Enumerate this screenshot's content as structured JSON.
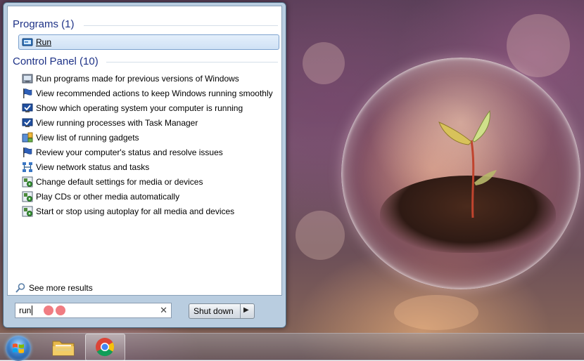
{
  "programs": {
    "header": "Programs (1)",
    "items": [
      {
        "label": "Run",
        "icon": "run-icon"
      }
    ]
  },
  "control_panel": {
    "header": "Control Panel (10)",
    "items": [
      {
        "label": "Run programs made for previous versions of Windows",
        "icon": "compatibility-icon"
      },
      {
        "label": "View recommended actions to keep Windows running smoothly",
        "icon": "action-center-flag-icon"
      },
      {
        "label": "Show which operating system your computer is running",
        "icon": "system-check-icon"
      },
      {
        "label": "View running processes with Task Manager",
        "icon": "task-manager-icon"
      },
      {
        "label": "View list of running gadgets",
        "icon": "gadgets-icon"
      },
      {
        "label": "Review your computer's status and resolve issues",
        "icon": "action-center-flag-icon"
      },
      {
        "label": "View network status and tasks",
        "icon": "network-icon"
      },
      {
        "label": "Change default settings for media or devices",
        "icon": "autoplay-icon"
      },
      {
        "label": "Play CDs or other media automatically",
        "icon": "autoplay-icon"
      },
      {
        "label": "Start or stop using autoplay for all media and devices",
        "icon": "autoplay-icon"
      }
    ]
  },
  "see_more": {
    "label": "See more results",
    "icon": "search-icon"
  },
  "search": {
    "value": "run",
    "clear_icon": "close-icon"
  },
  "shutdown": {
    "label": "Shut down",
    "arrow_icon": "chevron-right-icon"
  },
  "taskbar": {
    "start": {
      "icon": "windows-start-orb-icon"
    },
    "pinned": [
      {
        "name": "Windows Explorer",
        "icon": "folder-icon"
      },
      {
        "name": "Google Chrome",
        "icon": "chrome-icon"
      }
    ]
  },
  "colors": {
    "header_blue": "#1e3287",
    "highlight_border": "#7da2ce",
    "menu_frame": "#b9cde0"
  }
}
